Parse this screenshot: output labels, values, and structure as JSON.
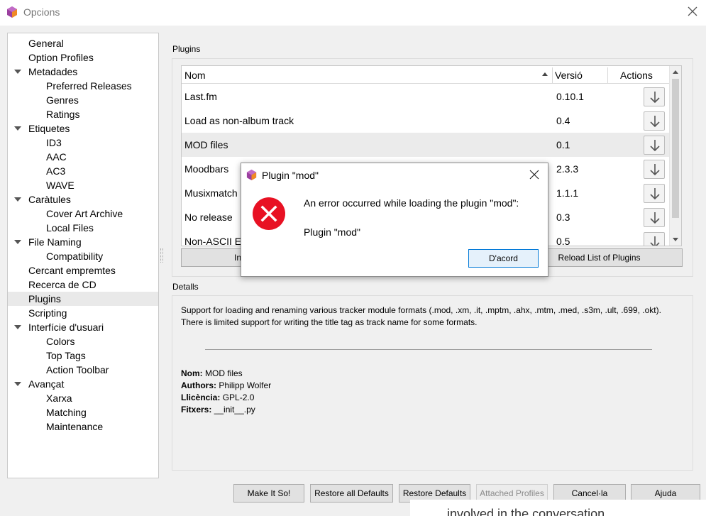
{
  "window": {
    "title": "Opcions"
  },
  "sidebar": {
    "items": [
      {
        "label": "General",
        "level": 0,
        "expanded": false
      },
      {
        "label": "Option Profiles",
        "level": 0,
        "expanded": false
      },
      {
        "label": "Metadades",
        "level": 0,
        "expanded": true
      },
      {
        "label": "Preferred Releases",
        "level": 1,
        "expanded": false
      },
      {
        "label": "Genres",
        "level": 1,
        "expanded": false
      },
      {
        "label": "Ratings",
        "level": 1,
        "expanded": false
      },
      {
        "label": "Etiquetes",
        "level": 0,
        "expanded": true
      },
      {
        "label": "ID3",
        "level": 1,
        "expanded": false
      },
      {
        "label": "AAC",
        "level": 1,
        "expanded": false
      },
      {
        "label": "AC3",
        "level": 1,
        "expanded": false
      },
      {
        "label": "WAVE",
        "level": 1,
        "expanded": false
      },
      {
        "label": "Caràtules",
        "level": 0,
        "expanded": true
      },
      {
        "label": "Cover Art Archive",
        "level": 1,
        "expanded": false
      },
      {
        "label": "Local Files",
        "level": 1,
        "expanded": false
      },
      {
        "label": "File Naming",
        "level": 0,
        "expanded": true
      },
      {
        "label": "Compatibility",
        "level": 1,
        "expanded": false
      },
      {
        "label": "Cercant empremtes",
        "level": 0,
        "expanded": false
      },
      {
        "label": "Recerca de CD",
        "level": 0,
        "expanded": false
      },
      {
        "label": "Plugins",
        "level": 0,
        "expanded": false,
        "selected": true
      },
      {
        "label": "Scripting",
        "level": 0,
        "expanded": false
      },
      {
        "label": "Interfície d'usuari",
        "level": 0,
        "expanded": true
      },
      {
        "label": "Colors",
        "level": 1,
        "expanded": false
      },
      {
        "label": "Top Tags",
        "level": 1,
        "expanded": false
      },
      {
        "label": "Action Toolbar",
        "level": 1,
        "expanded": false
      },
      {
        "label": "Avançat",
        "level": 0,
        "expanded": true
      },
      {
        "label": "Xarxa",
        "level": 1,
        "expanded": false
      },
      {
        "label": "Matching",
        "level": 1,
        "expanded": false
      },
      {
        "label": "Maintenance",
        "level": 1,
        "expanded": false
      }
    ]
  },
  "plugins": {
    "group_label": "Plugins",
    "columns": {
      "name": "Nom",
      "version": "Versió",
      "actions": "Actions"
    },
    "rows": [
      {
        "name": "Last.fm",
        "version": "0.10.1",
        "highlighted": false
      },
      {
        "name": "Load as non-album track",
        "version": "0.4",
        "highlighted": false
      },
      {
        "name": "MOD files",
        "version": "0.1",
        "highlighted": true
      },
      {
        "name": "Moodbars",
        "version": "2.3.3",
        "highlighted": false
      },
      {
        "name": "Musixmatch",
        "version": "1.1.1",
        "highlighted": false
      },
      {
        "name": "No release",
        "version": "0.3",
        "highlighted": false
      },
      {
        "name": "Non-ASCII E",
        "version": "0.5",
        "highlighted": false
      }
    ],
    "install_button": "Ins",
    "reload_button": "Reload List of Plugins"
  },
  "details": {
    "group_label": "Detalls",
    "description": "Support for loading and renaming various tracker module formats (.mod, .xm, .it, .mptm, .ahx, .mtm, .med, .s3m, .ult, .699, .okt). There is limited support for writing the title tag as track name for some formats.",
    "fields": [
      {
        "key": "Nom:",
        "value": "MOD files"
      },
      {
        "key": "Authors:",
        "value": "Philipp Wolfer"
      },
      {
        "key": "Llicència:",
        "value": "GPL-2.0"
      },
      {
        "key": "Fitxers:",
        "value": "__init__.py"
      }
    ]
  },
  "footer": {
    "make_it_so": "Make It So!",
    "restore_all": "Restore all Defaults",
    "restore": "Restore Defaults",
    "attached_profiles": "Attached Profiles",
    "cancel": "Cancel·la",
    "help": "Ajuda"
  },
  "background_text": "involved in the conversation",
  "dialog": {
    "title": "Plugin \"mod\"",
    "message": "An error occurred while loading the plugin \"mod\":",
    "detail": "Plugin \"mod\"",
    "ok": "D'acord"
  },
  "icons": {
    "app": "picard-logo-icon",
    "close": "close-icon",
    "error": "error-icon",
    "download": "arrow-down-icon"
  },
  "colors": {
    "error_red": "#e81123",
    "focus_blue": "#0078d7",
    "selection_gray": "#e9e9e9"
  }
}
